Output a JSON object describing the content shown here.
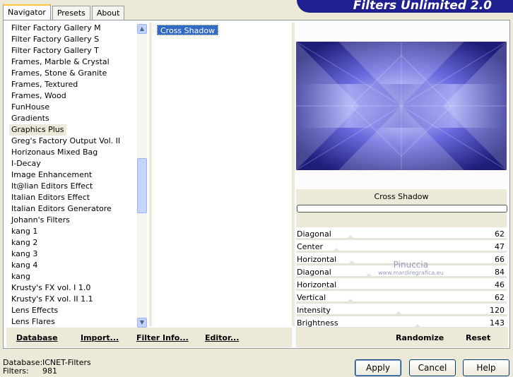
{
  "title": "Filters Unlimited 2.0",
  "tabs": [
    "Navigator",
    "Presets",
    "About"
  ],
  "categories": [
    "Filter Factory Gallery M",
    "Filter Factory Gallery S",
    "Filter Factory Gallery T",
    "Frames, Marble & Crystal",
    "Frames, Stone & Granite",
    "Frames, Textured",
    "Frames, Wood",
    "FunHouse",
    "Gradients",
    "Graphics Plus",
    "Greg's Factory Output Vol. II",
    "Horizonaus Mixed Bag",
    "I-Decay",
    "Image Enhancement",
    "It@lian Editors Effect",
    "Italian Editors Effect",
    "Italian Editors Generatore",
    "Johann's Filters",
    "kang 1",
    "kang 2",
    "kang 3",
    "kang 4",
    "kang",
    "Krusty's FX vol. I 1.0",
    "Krusty's FX vol. II 1.1",
    "Lens Effects",
    "Lens Flares"
  ],
  "selected_category": "Graphics Plus",
  "filters": [
    "Cross Shadow"
  ],
  "selected_filter_name": "Cross Shadow",
  "sliders": [
    {
      "label": "Diagonal",
      "value": "62"
    },
    {
      "label": "Center",
      "value": "47"
    },
    {
      "label": "Horizontal",
      "value": "66"
    },
    {
      "label": "Diagonal",
      "value": "84"
    },
    {
      "label": "Horizontal",
      "value": "46"
    },
    {
      "label": "Vertical",
      "value": "62"
    },
    {
      "label": "Intensity",
      "value": "120"
    },
    {
      "label": "Brightness",
      "value": "143"
    }
  ],
  "left_actions": [
    "Database",
    "Import...",
    "Filter Info...",
    "Editor..."
  ],
  "right_actions": [
    "Randomize",
    "Reset"
  ],
  "status": {
    "database_label": "Database:",
    "database_value": "ICNET-Filters",
    "filters_label": "Filters:",
    "filters_value": "981"
  },
  "buttons": {
    "apply": "Apply",
    "cancel": "Cancel",
    "help": "Help"
  },
  "watermark": {
    "name": "Pinuccia",
    "site": "www.mardiregrafica.eu"
  },
  "colors": {
    "accent": "#316ac5",
    "banner": "#1f1f8f",
    "preview": "#5a5ad8"
  }
}
